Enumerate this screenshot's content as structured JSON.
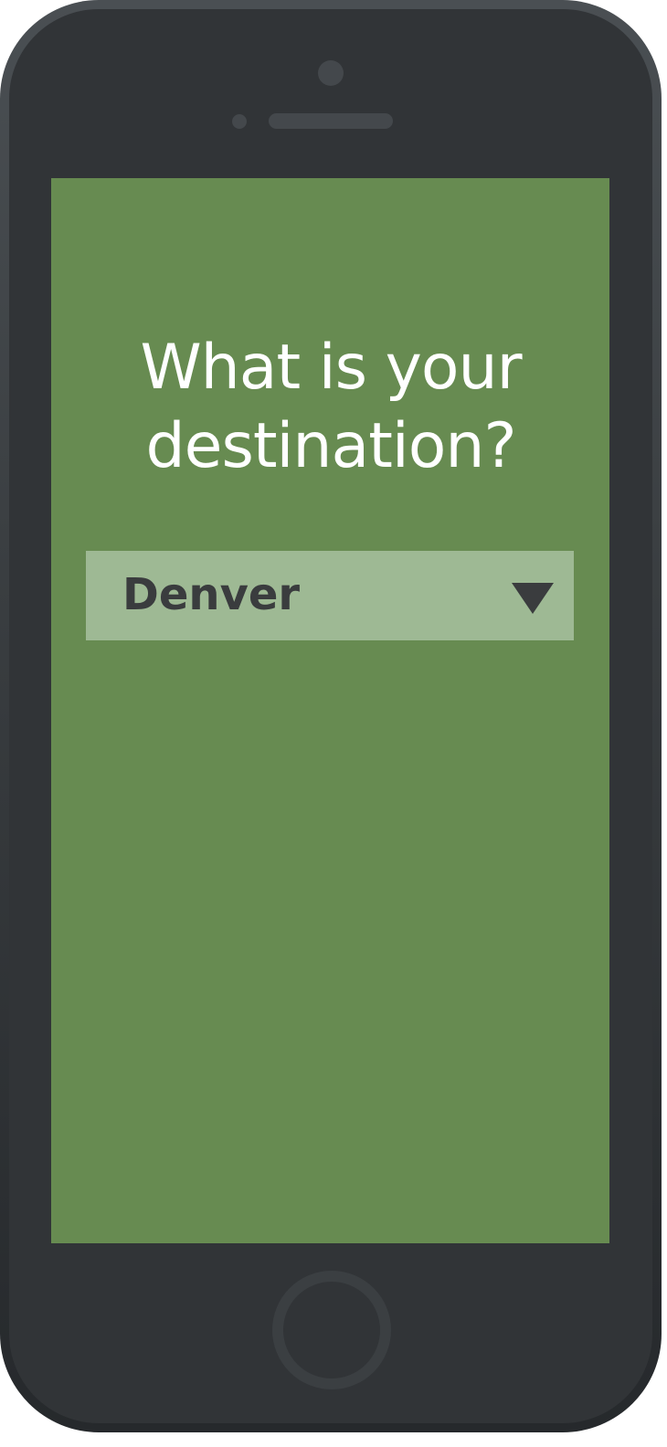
{
  "screen": {
    "question_line1": "What is your",
    "question_line2": "destination?",
    "destination_select": {
      "selected_value": "Denver",
      "icon": "triangle-down-icon"
    }
  },
  "colors": {
    "screen_background": "#678b51",
    "select_background": "#9eb994",
    "select_text": "#3a3c3e",
    "question_text": "#ffffff",
    "device_body": "#313437"
  }
}
